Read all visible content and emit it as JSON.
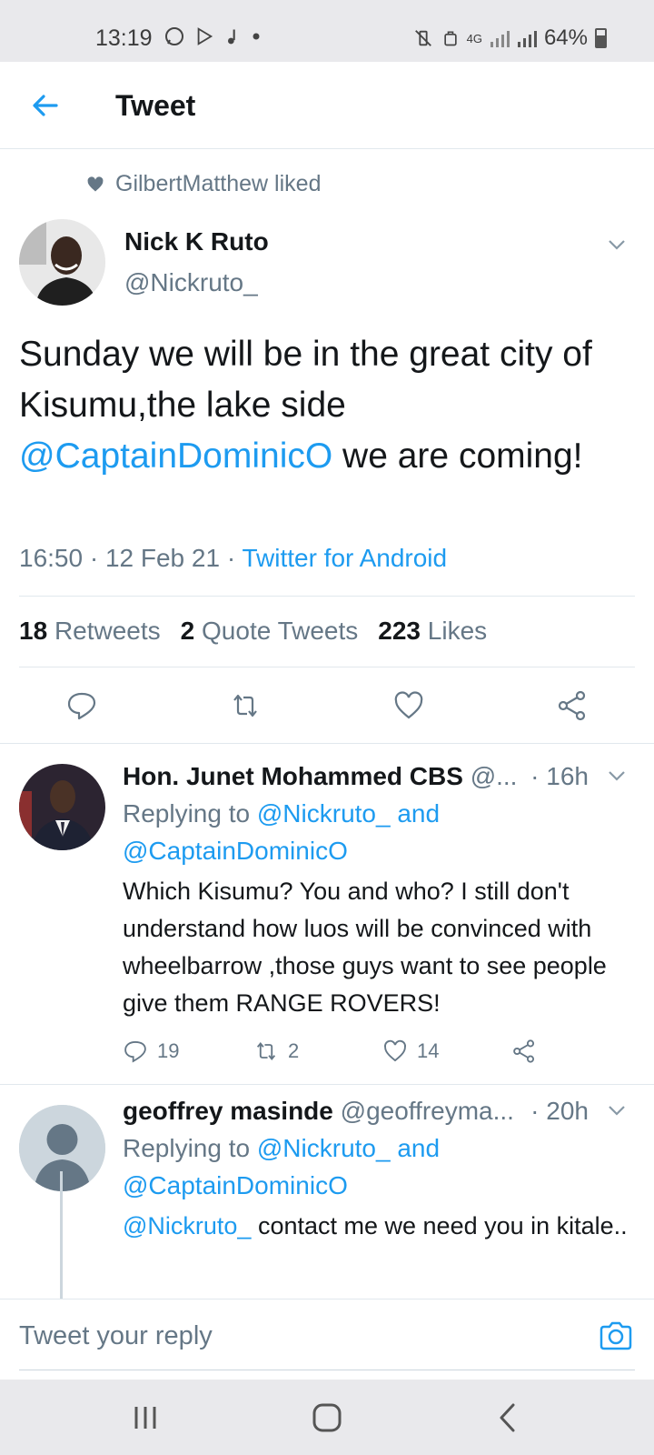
{
  "status_bar": {
    "time": "13:19",
    "network": "4G",
    "battery": "64%",
    "battery_level": 0.64
  },
  "header": {
    "title": "Tweet",
    "back_icon": "back-arrow-icon"
  },
  "social_context": {
    "text": "GilbertMatthew liked",
    "icon": "heart-icon"
  },
  "tweet": {
    "author_name": "Nick K Ruto",
    "author_handle": "@Nickruto_",
    "text_part1": "Sunday we will be in the great city of Kisumu,the lake side ",
    "mention": "@CaptainDominicO",
    "text_part2": " we are coming!",
    "time_date": "16:50 · 12 Feb 21 · ",
    "source": "Twitter for Android",
    "stats": {
      "retweets_count": "18",
      "retweets_label": "Retweets",
      "quotes_count": "2",
      "quotes_label": "Quote Tweets",
      "likes_count": "223",
      "likes_label": "Likes"
    }
  },
  "replies": [
    {
      "name": "Hon. Junet Mohammed CBS",
      "handle": "@...",
      "time": "· 16h",
      "replying_prefix": "Replying to ",
      "replying_mentions": "@Nickruto_ and",
      "replying_mentions2": "@CaptainDominicO",
      "text": "Which Kisumu? You and who? I still don't understand how luos will be convinced with wheelbarrow ,those guys want to see people give them RANGE ROVERS!",
      "reply_count": "19",
      "retweet_count": "2",
      "like_count": "14"
    },
    {
      "name": "geoffrey masinde",
      "handle": "@geoffreyma...",
      "time": "· 20h",
      "replying_prefix": "Replying to ",
      "replying_mentions": "@Nickruto_ and",
      "replying_mentions2": "@CaptainDominicO",
      "text_mention": "@Nickruto_",
      "text": " contact me we need you in kitale.."
    }
  ],
  "reply_box": {
    "placeholder": "Tweet your reply"
  },
  "colors": {
    "accent": "#1d9bf0",
    "secondary_text": "#657786",
    "primary_text": "#14171a"
  }
}
